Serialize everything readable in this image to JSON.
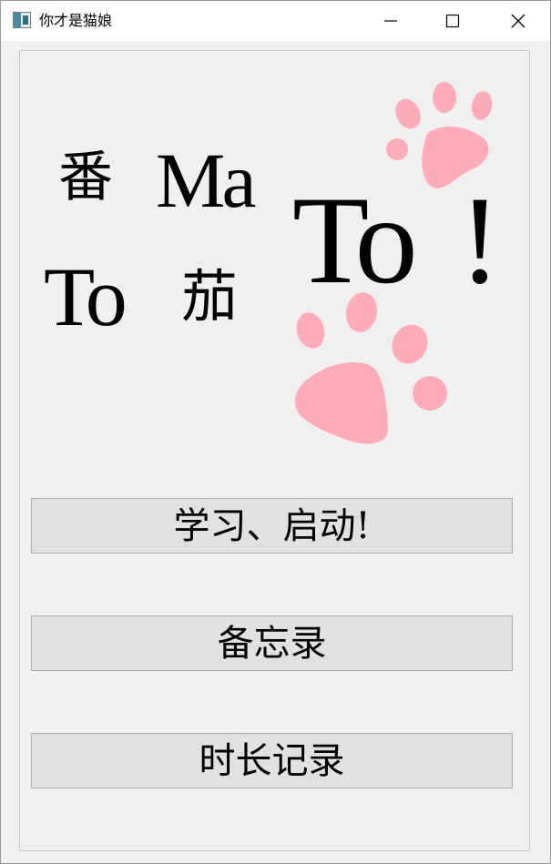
{
  "window": {
    "title": "你才是猫娘",
    "icon": "app-window-icon"
  },
  "controls": {
    "minimize": "minimize-icon",
    "maximize": "maximize-icon",
    "close": "close-icon"
  },
  "logo": {
    "fan": "番",
    "ma": "Ma",
    "to_small": "To",
    "qie": "茄",
    "to_big": "To",
    "exclaim": "!"
  },
  "decor": {
    "paw_color": "#ffa8b6",
    "paw_icon": "paw-print-icon"
  },
  "buttons": {
    "study": "学习、启动!",
    "memo": "备忘录",
    "time_log": "时长记录"
  }
}
